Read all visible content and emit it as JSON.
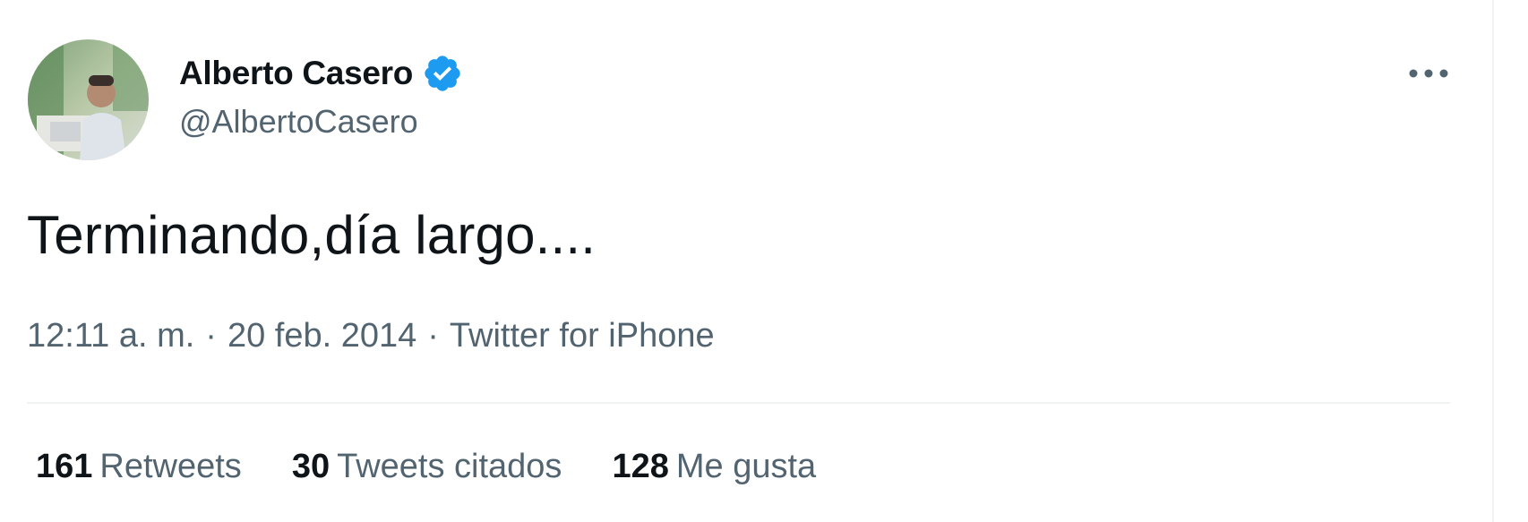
{
  "user": {
    "display_name": "Alberto Casero",
    "handle": "@AlbertoCasero",
    "verified": true,
    "avatar_icon": "profile-photo"
  },
  "tweet": {
    "text": "Terminando,día largo....",
    "time": "12:11 a. m.",
    "date": "20 feb. 2014",
    "source": "Twitter for iPhone",
    "separator": "·"
  },
  "stats": {
    "retweets_count": "161",
    "retweets_label": "Retweets",
    "quotes_count": "30",
    "quotes_label": "Tweets citados",
    "likes_count": "128",
    "likes_label": "Me gusta"
  },
  "colors": {
    "text_primary": "#0f1419",
    "text_secondary": "#536471",
    "verified_blue": "#1d9bf0",
    "divider": "#eff3f4"
  }
}
